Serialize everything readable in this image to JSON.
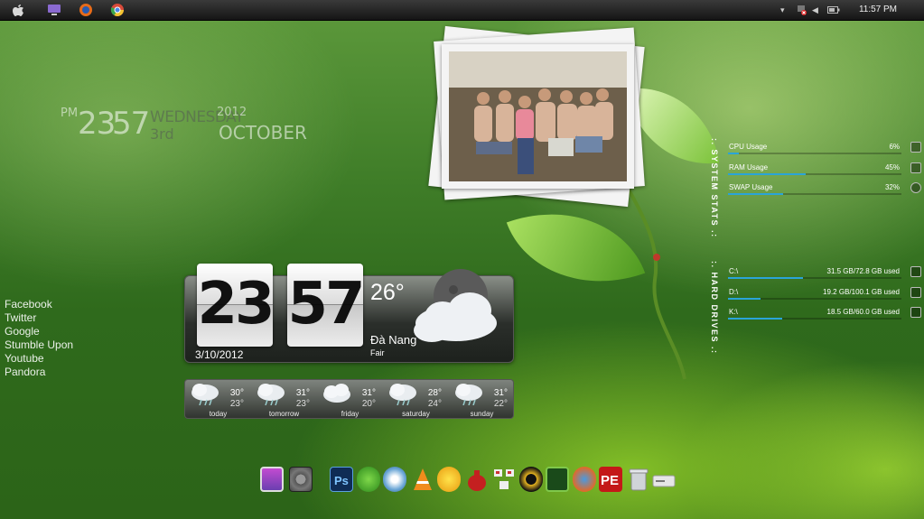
{
  "taskbar": {
    "time": "11:57 PM"
  },
  "text_clock": {
    "ampm": "PM",
    "hours": "23",
    "minutes": "57",
    "weekday": "WEDNESDAY",
    "year": "2012",
    "day": "3rd",
    "month": "OCTOBER"
  },
  "links": [
    "Facebook",
    "Twitter",
    "Google",
    "Stumble Upon",
    "Youtube",
    "Pandora"
  ],
  "system_stats": {
    "heading": ":. SYSTEM STATS .:",
    "items": [
      {
        "label": "CPU Usage",
        "value": "6%",
        "percent": 6
      },
      {
        "label": "RAM Usage",
        "value": "45%",
        "percent": 45
      },
      {
        "label": "SWAP Usage",
        "value": "32%",
        "percent": 32
      }
    ]
  },
  "hard_drives": {
    "heading": ":. HARD DRIVES .:",
    "items": [
      {
        "label": "C:\\",
        "value": "31.5 GB/72.8 GB used",
        "percent": 43
      },
      {
        "label": "D:\\",
        "value": "19.2 GB/100.1 GB used",
        "percent": 19
      },
      {
        "label": "K:\\",
        "value": "18.5 GB/60.0 GB used",
        "percent": 31
      }
    ]
  },
  "weather_clock": {
    "hours": "23",
    "minutes": "57",
    "date": "3/10/2012",
    "temperature": "26°",
    "city": "Đà Nang",
    "condition": "Fair"
  },
  "forecast": [
    {
      "day": "today",
      "high": "30°",
      "low": "23°"
    },
    {
      "day": "tomorrow",
      "high": "31°",
      "low": "23°"
    },
    {
      "day": "friday",
      "high": "31°",
      "low": "20°"
    },
    {
      "day": "saturday",
      "high": "28°",
      "low": "24°"
    },
    {
      "day": "sunday",
      "high": "31°",
      "low": "22°"
    }
  ],
  "icons": {
    "taskbar": [
      "apple-icon",
      "monitor-icon",
      "firefox-icon",
      "chrome-icon"
    ],
    "tray": [
      "arrow-up-icon",
      "network-error-icon",
      "volume-icon",
      "battery-icon"
    ],
    "dock": [
      "imac-icon",
      "system-preferences-icon",
      "photoshop-icon",
      "utorrent-icon",
      "safari-icon",
      "vlc-icon",
      "messenger-icon",
      "money-bag-icon",
      "network-icon",
      "garena-icon",
      "terminal-icon",
      "mail-icon",
      "pe-icon",
      "trash-icon",
      "drive-icon"
    ]
  },
  "colors": {
    "stat_bar": "#2aa4d8",
    "topbar": "#1c1c1c"
  }
}
